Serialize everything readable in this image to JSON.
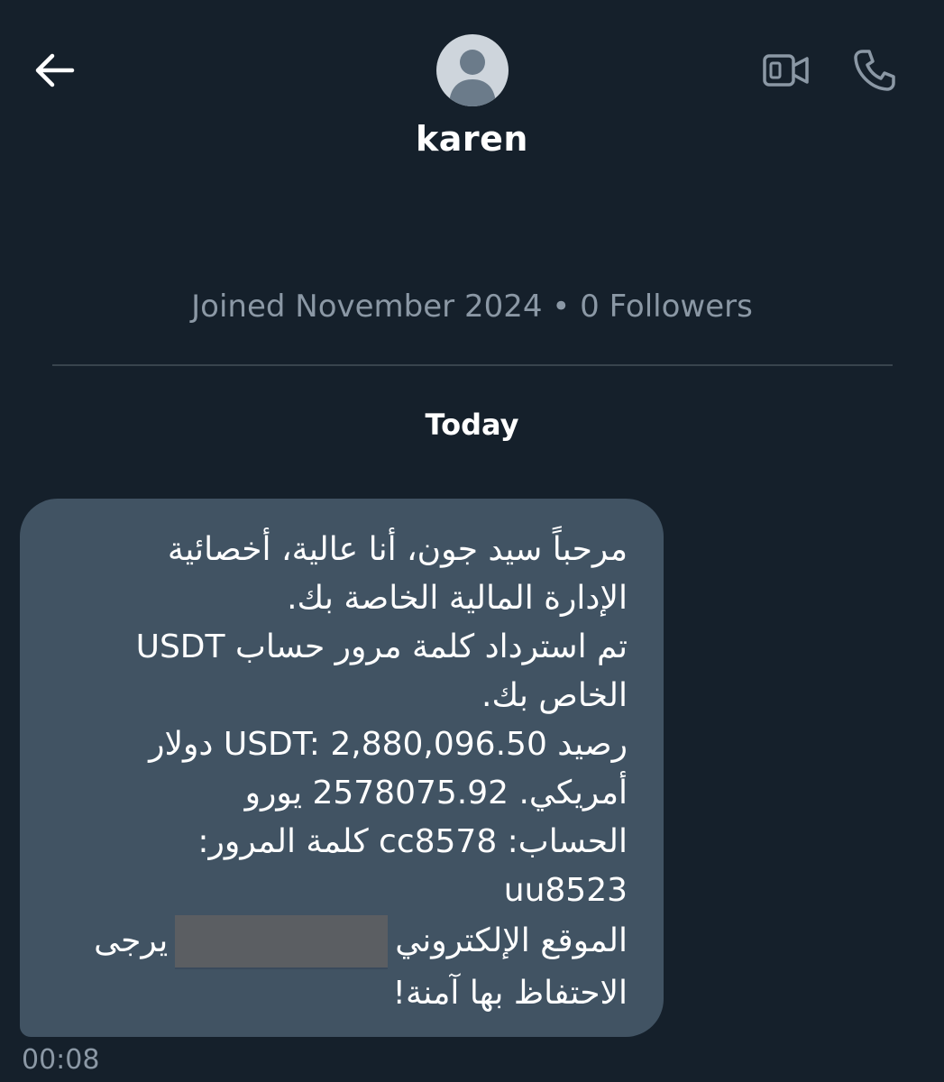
{
  "header": {
    "back_icon": "arrow-left-icon",
    "avatar_icon": "default-avatar-icon",
    "contact_name": "karen",
    "video_icon": "video-camera-icon",
    "call_icon": "phone-icon"
  },
  "profile": {
    "meta": "Joined November 2024 • 0 Followers"
  },
  "conversation": {
    "date_label": "Today",
    "messages": [
      {
        "direction": "incoming",
        "lines": [
          "مرحباً سيد جون، أنا عالية، أخصائية",
          "الإدارة المالية الخاصة بك.",
          "تم استرداد كلمة مرور حساب USDT",
          "الخاص بك.",
          "رصيد USDT: 2,880,096.50 دولار",
          "أمريكي. 2578075.92 يورو",
          "الحساب: cc8578  كلمة المرور:",
          "uu8523",
          "الموقع الإلكتروني",
          "يرجى",
          "الاحتفاظ بها آمنة!"
        ],
        "time": "00:08"
      }
    ]
  },
  "colors": {
    "background": "#15202b",
    "bubble": "#415363",
    "muted_text": "#8b98a5",
    "divider": "#38444d",
    "redaction": "#5b5e62"
  }
}
